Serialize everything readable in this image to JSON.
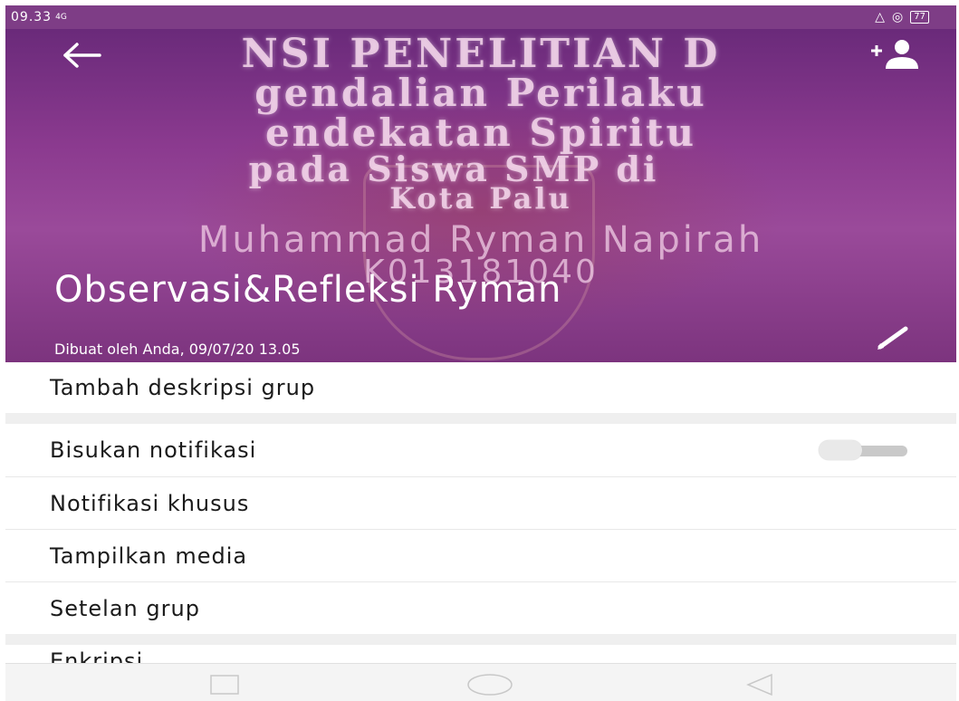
{
  "status_bar": {
    "time": "09.33",
    "signal": "4G",
    "battery": "77"
  },
  "header": {
    "banner_lines": [
      "NSI PENELITIAN D",
      "gendalian Perilaku",
      "endekatan Spiritu",
      "pada Siswa SMP di",
      "Kota Palu"
    ],
    "author": "Muhammad Ryman Napirah",
    "nim": "K013181040",
    "group_name": "Observasi&Refleksi Ryman",
    "created_by": "Dibuat oleh Anda, 09/07/20 13.05"
  },
  "list": {
    "add_description": "Tambah deskripsi grup",
    "mute_notifications": "Bisukan notifikasi",
    "mute_state": "off",
    "custom_notifications": "Notifikasi khusus",
    "show_media": "Tampilkan media",
    "group_settings": "Setelan grup",
    "next_item_partial": "Enkripsi"
  },
  "icons": {
    "back": "arrow-left-icon",
    "add_participant": "add-person-icon",
    "edit": "pencil-icon"
  },
  "colors": {
    "status_bar": "#7e3d86",
    "header_purple": "#8b3a8f"
  }
}
